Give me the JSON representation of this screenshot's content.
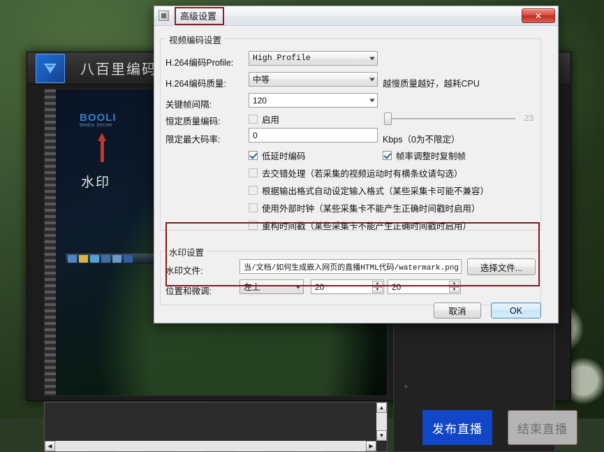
{
  "desktop": {
    "wallpaper_desc": "green leaves with white flowers"
  },
  "app": {
    "title": "八百里编码器",
    "logo_icon": "blue-triangle-logo",
    "close_icon": "close-x-icon",
    "minimize_icon": "minimize-icon",
    "preview": {
      "watermark_brand_line1": "BOOLI",
      "watermark_brand_line2": "Media Server",
      "watermark_label": "水印",
      "arrow_icon": "red-up-arrow-icon",
      "taskbar_icons": [
        "explorer-icon",
        "folder-icon",
        "browser-icon",
        "media-icon",
        "app-icon",
        "window-icon"
      ]
    },
    "log": {
      "text": ""
    },
    "scrollbars": {
      "up_icon": "▲",
      "down_icon": "▼",
      "left_icon": "◀",
      "right_icon": "▶"
    },
    "buttons": {
      "publish": "发布直播",
      "stop": "结束直播"
    },
    "publish_color": "#1146c8",
    "stop_color": "#b4b4b4"
  },
  "dialog": {
    "title": "高级设置",
    "title_highlight_color": "#8c1f1f",
    "icon": "window-icon",
    "close_label": "✕",
    "video_group": {
      "title": "视频编码设置",
      "profile": {
        "label": "H.264编码Profile:",
        "value": "High Profile"
      },
      "quality": {
        "label": "H.264编码质量:",
        "value": "中等",
        "hint": "越慢质量越好，越耗CPU"
      },
      "keyframe": {
        "label": "关键帧间隔:",
        "value": "120"
      },
      "crf": {
        "label": "恒定质量编码:",
        "checkbox_label": "启用",
        "checked": false,
        "slider_value": "23"
      },
      "maxbitrate": {
        "label": "限定最大码率:",
        "value": "0",
        "unit": "Kbps（0为不限定）"
      },
      "checkboxes": [
        {
          "label": "低延时编码",
          "checked": true
        },
        {
          "label": "帧率调整时复制帧",
          "checked": true
        },
        {
          "label": "去交错处理（若采集的视频运动时有横条纹请勾选）",
          "checked": false
        },
        {
          "label": "根据输出格式自动设定输入格式（某些采集卡可能不兼容）",
          "checked": false
        },
        {
          "label": "使用外部时钟（某些采集卡不能产生正确时间戳时启用）",
          "checked": false
        },
        {
          "label": "重构时间戳（某些采集卡不能产生正确时间戳时启用）",
          "checked": false
        }
      ]
    },
    "watermark_group": {
      "title": "水印设置",
      "annotation_color": "#7c1a1a",
      "file": {
        "label": "水印文件:",
        "value": "当/文档/如何生成嵌入网页的直播HTML代码/watermark.png",
        "browse_button": "选择文件..."
      },
      "position": {
        "label": "位置和微调:",
        "value": "左上",
        "offset_x": "20",
        "offset_y": "20"
      }
    },
    "footer": {
      "cancel": "取消",
      "ok": "OK"
    }
  }
}
